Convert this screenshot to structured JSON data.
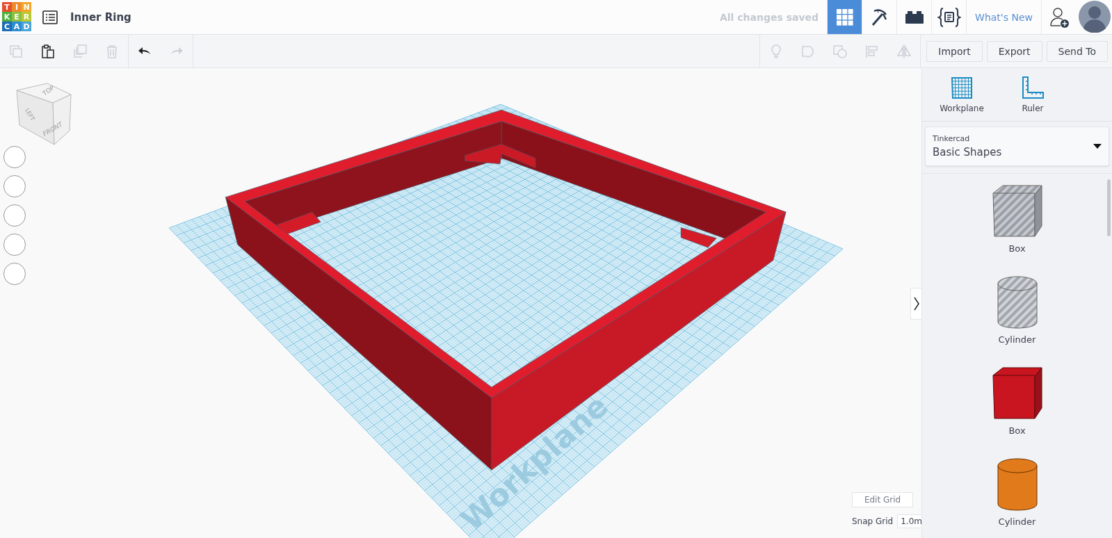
{
  "header": {
    "logo_letters": [
      {
        "text": "T",
        "color": "#e5502b"
      },
      {
        "text": "I",
        "color": "#ef8a2c"
      },
      {
        "text": "N",
        "color": "#f3a729"
      },
      {
        "text": "K",
        "color": "#4fae3c"
      },
      {
        "text": "E",
        "color": "#8cc13f"
      },
      {
        "text": "R",
        "color": "#b9c832"
      },
      {
        "text": "C",
        "color": "#1c6db6"
      },
      {
        "text": "A",
        "color": "#2c8bd2"
      },
      {
        "text": "D",
        "color": "#4aa6da"
      }
    ],
    "design_title": "Inner Ring",
    "save_status": "All changes saved",
    "view_buttons": [
      {
        "kind": "grid",
        "selected": true
      },
      {
        "kind": "pickaxe",
        "selected": false
      },
      {
        "kind": "brick",
        "selected": false
      },
      {
        "kind": "codeblocks",
        "selected": false
      }
    ],
    "whats_new": "What's New"
  },
  "toolbar": {
    "edit_tools": [
      {
        "kind": "copy",
        "disabled": true
      },
      {
        "kind": "paste",
        "disabled": false
      },
      {
        "kind": "duplicate",
        "disabled": true
      },
      {
        "kind": "delete",
        "disabled": true
      }
    ],
    "history": [
      {
        "kind": "undo",
        "disabled": false
      },
      {
        "kind": "redo",
        "disabled": true
      }
    ],
    "shape_tools": [
      {
        "kind": "bulb",
        "disabled": true
      },
      {
        "kind": "group",
        "disabled": true
      },
      {
        "kind": "ungroup",
        "disabled": true
      },
      {
        "kind": "align",
        "disabled": true
      },
      {
        "kind": "mirror",
        "disabled": true
      }
    ],
    "actions": [
      "Import",
      "Export",
      "Send To"
    ]
  },
  "view_cube": {
    "top": "TOP",
    "left": "LEFT",
    "front": "FRONT"
  },
  "view_controls": [
    {
      "kind": "blank"
    },
    {
      "kind": "blank"
    },
    {
      "kind": "blank"
    },
    {
      "kind": "blank"
    },
    {
      "kind": "blank"
    }
  ],
  "canvas": {
    "workplane_label": "Workplane",
    "edit_grid": "Edit Grid",
    "snap_grid_label": "Snap Grid",
    "snap_grid_value": "1.0m"
  },
  "panel": {
    "tools": [
      {
        "kind": "workplane",
        "label": "Workplane"
      },
      {
        "kind": "ruler",
        "label": "Ruler"
      }
    ],
    "library": {
      "category": "Tinkercad",
      "selection": "Basic Shapes"
    },
    "shapes": [
      {
        "kind": "hole_box",
        "label": "Box"
      },
      {
        "kind": "hole_cylinder",
        "label": "Cylinder"
      },
      {
        "kind": "box",
        "label": "Box",
        "color": "#c8151f"
      },
      {
        "kind": "cylinder",
        "label": "Cylinder",
        "color": "#e07a1a"
      }
    ]
  }
}
